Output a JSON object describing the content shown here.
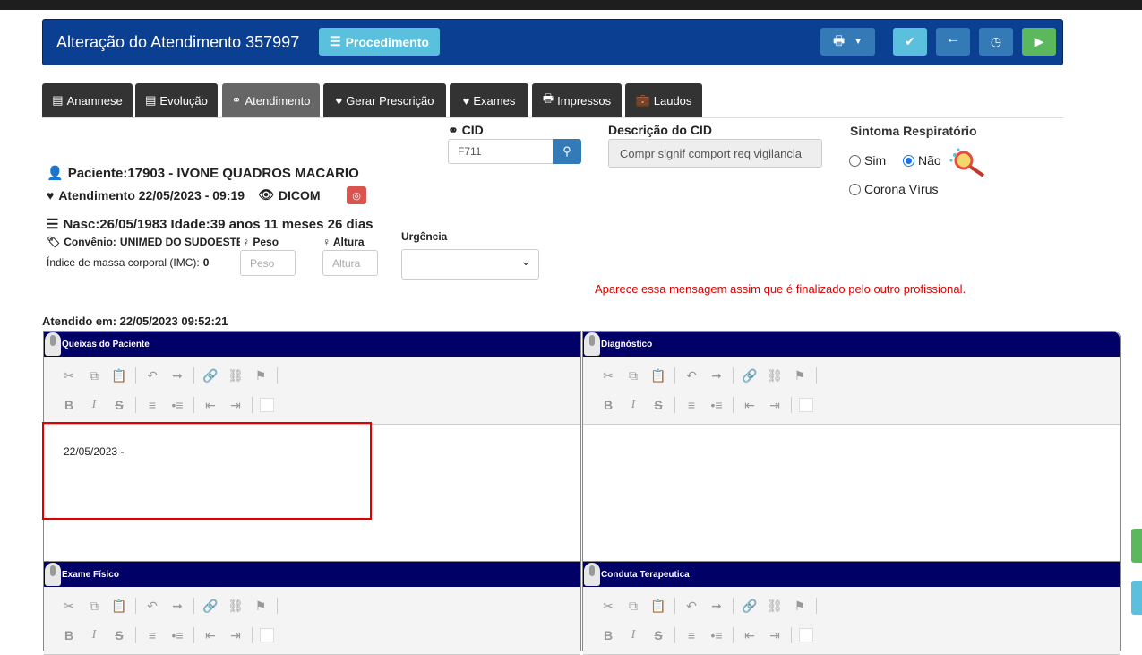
{
  "header": {
    "title": "Alteração do Atendimento 357997",
    "procedimento_label": "Procedimento",
    "colors": {
      "bar": "#0a3f91",
      "info": "#5bc0de",
      "primary": "#337ab7",
      "success": "#5cb85c"
    },
    "icons": [
      "print-icon",
      "check-icon",
      "arrow-left-icon",
      "clock-icon",
      "video-icon"
    ]
  },
  "tabs": [
    {
      "label": "Anamnese",
      "icon": "calendar-icon"
    },
    {
      "label": "Evolução",
      "icon": "calendar-icon"
    },
    {
      "label": "Atendimento",
      "icon": "stethoscope-icon",
      "active": true
    },
    {
      "label": "Gerar Prescrição",
      "icon": "heart-icon"
    },
    {
      "label": "Exames",
      "icon": "heartbeat-icon"
    },
    {
      "label": "Impressos",
      "icon": "print-icon"
    },
    {
      "label": "Laudos",
      "icon": "briefcase-icon"
    }
  ],
  "cid": {
    "label": "CID",
    "value": "F711"
  },
  "cid_desc": {
    "label": "Descrição do CID",
    "value": "Compr signif comport req vigilancia"
  },
  "sintoma": {
    "label": "Sintoma Respiratório",
    "options": [
      "Sim",
      "Não",
      "Corona Vírus"
    ],
    "selected": "Não"
  },
  "patient": {
    "name": "Paciente:17903 - IVONE QUADROS MACARIO",
    "atendimento": "Atendimento 22/05/2023 - 09:19",
    "dicom": "DICOM",
    "nasc": "Nasc:26/05/1983 Idade:39 anos 11 meses 26 dias",
    "convenio_label": "Convênio:",
    "convenio_value": "UNIMED DO SUDOESTE",
    "imc_label": "Índice de massa corporal (IMC):",
    "imc_value": "0"
  },
  "peso": {
    "label": "Peso",
    "placeholder": "Peso"
  },
  "altura": {
    "label": "Altura",
    "placeholder": "Altura"
  },
  "urgencia": {
    "label": "Urgência",
    "value": ""
  },
  "message": "Aparece essa mensagem assim que é finalizado pelo outro profissional.",
  "atendido_em": "Atendido em: 22/05/2023 09:52:21",
  "panels": {
    "queixas": {
      "title": "Queixas do Paciente",
      "content": "22/05/2023 -"
    },
    "diagnostico": {
      "title": "Diagnóstico",
      "content": ""
    },
    "exame_fisico": {
      "title": "Exame Físico",
      "content": ""
    },
    "conduta": {
      "title": "Conduta Terapeutica",
      "content": ""
    }
  }
}
